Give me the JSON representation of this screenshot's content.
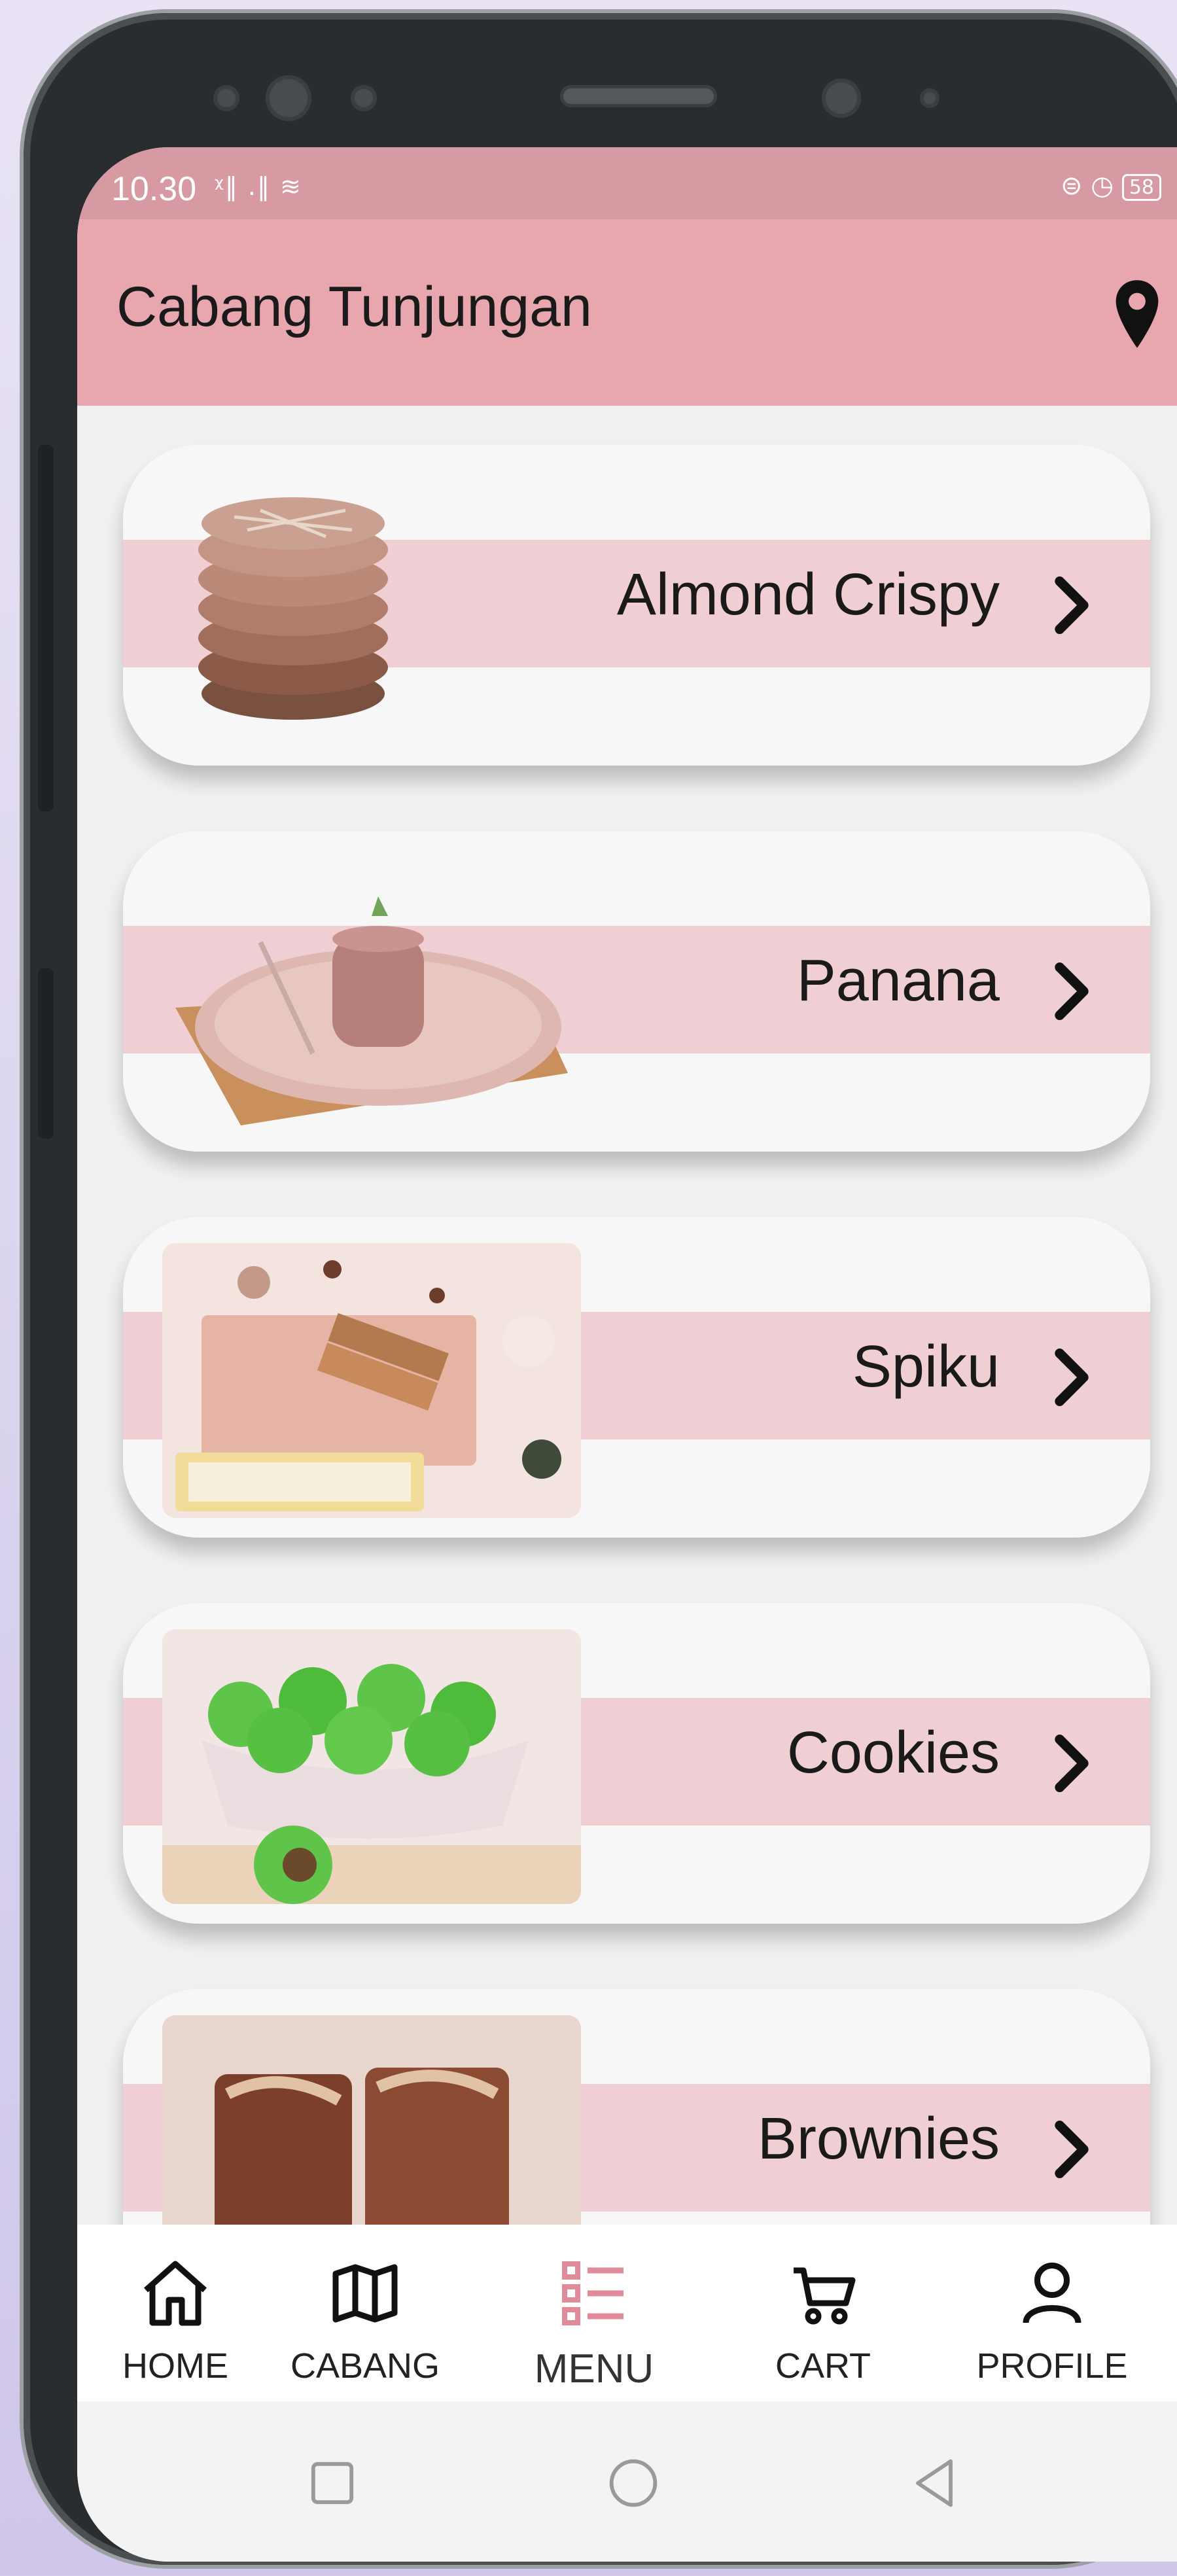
{
  "status_bar": {
    "time": "10.30",
    "signal": "ᵡ‖ .‖ ≋",
    "battery": "58"
  },
  "app_bar": {
    "title": "Cabang Tunjungan",
    "location_icon": "map-pin-icon"
  },
  "menu": {
    "items": [
      {
        "label": "Almond Crispy"
      },
      {
        "label": "Panana"
      },
      {
        "label": "Spiku"
      },
      {
        "label": "Cookies"
      },
      {
        "label": "Brownies"
      }
    ]
  },
  "bottom_nav": {
    "items": [
      {
        "label": "HOME",
        "icon": "home-icon"
      },
      {
        "label": "CABANG",
        "icon": "map-icon"
      },
      {
        "label": "MENU",
        "icon": "list-icon",
        "active": true
      },
      {
        "label": "CART",
        "icon": "cart-icon"
      },
      {
        "label": "PROFILE",
        "icon": "user-icon"
      }
    ]
  },
  "colors": {
    "app_bar": "#e8a6ae",
    "card_band": "#f0cfd4",
    "active_nav_icon": "#e08b99"
  }
}
